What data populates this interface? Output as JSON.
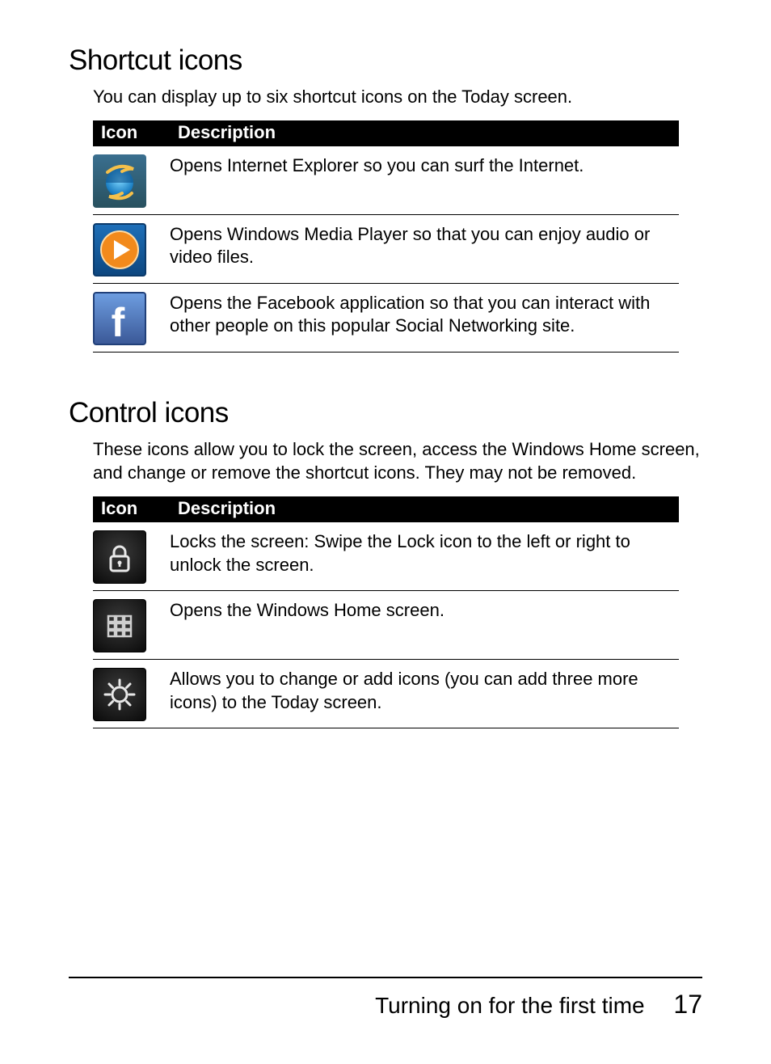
{
  "sections": [
    {
      "title": "Shortcut icons",
      "intro": "You can display up to six shortcut icons on the Today screen.",
      "table": {
        "headers": {
          "icon": "Icon",
          "desc": "Description"
        },
        "rows": [
          {
            "icon_name": "internet-explorer-icon",
            "desc": "Opens Internet Explorer so you can surf the Internet."
          },
          {
            "icon_name": "windows-media-player-icon",
            "desc": "Opens Windows Media Player so that you can enjoy audio or video files."
          },
          {
            "icon_name": "facebook-icon",
            "desc": "Opens the Facebook application so that you can interact with other people on this popular Social Networking site."
          }
        ]
      }
    },
    {
      "title": "Control icons",
      "intro": "These icons allow you to lock the screen, access the Windows Home screen, and change or remove the shortcut icons. They may not be removed.",
      "table": {
        "headers": {
          "icon": "Icon",
          "desc": "Description"
        },
        "rows": [
          {
            "icon_name": "lock-icon",
            "desc": "Locks the screen: Swipe the Lock icon to the left or right to unlock the screen."
          },
          {
            "icon_name": "home-grid-icon",
            "desc": "Opens the Windows Home screen."
          },
          {
            "icon_name": "settings-gear-icon",
            "desc": "Allows you to change or add icons (you can add three more icons) to the Today screen."
          }
        ]
      }
    }
  ],
  "footer": {
    "chapter": "Turning on for the first time",
    "page": "17"
  }
}
